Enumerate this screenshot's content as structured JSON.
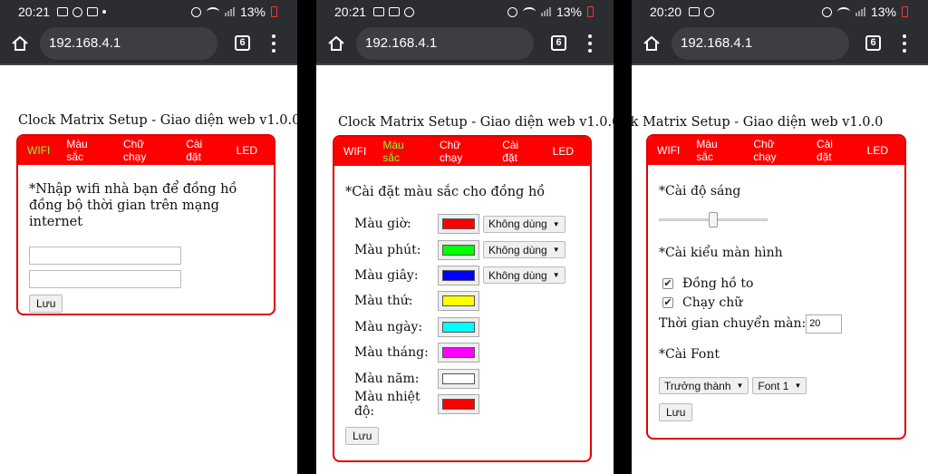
{
  "url": "192.168.4.1",
  "tab_count": "6",
  "page_title": "Clock Matrix Setup - Giao diện web v1.0.0",
  "nav": [
    "WIFI",
    "Màu sắc",
    "Chữ chạy",
    "Cài đặt",
    "LED"
  ],
  "phones": [
    {
      "time": "20:21",
      "battery": "13%"
    },
    {
      "time": "20:21",
      "battery": "13%"
    },
    {
      "time": "20:20",
      "battery": "13%"
    }
  ],
  "wifi_page": {
    "instruction": "*Nhập wifi nhà bạn để đồng hồ đồng bộ thời gian trên mạng internet",
    "ssid_value": "",
    "password_value": "",
    "save_label": "Lưu"
  },
  "color_page": {
    "heading": "*Cài đặt màu sắc cho đồng hồ",
    "rows": [
      {
        "label": "Màu giờ:",
        "color": "#ff0000",
        "option": "Không dùng"
      },
      {
        "label": "Màu phút:",
        "color": "#00ff00",
        "option": "Không dùng"
      },
      {
        "label": "Màu giây:",
        "color": "#0000ff",
        "option": "Không dùng"
      },
      {
        "label": "Màu thứ:",
        "color": "#ffff00"
      },
      {
        "label": "Màu ngày:",
        "color": "#00ffff"
      },
      {
        "label": "Màu tháng:",
        "color": "#ff00ff"
      },
      {
        "label": "Màu năm:",
        "color": "#ffffff"
      },
      {
        "label": "Màu nhiệt độ:",
        "color": "#ff0000"
      }
    ],
    "save_label": "Lưu"
  },
  "settings_page": {
    "brightness_heading": "*Cài độ sáng",
    "brightness_level": 0.5,
    "display_heading": "*Cài kiểu màn hình",
    "options": [
      {
        "label": "Đồng hồ to",
        "checked": true
      },
      {
        "label": "Chạy chữ",
        "checked": true
      }
    ],
    "transition_label": "Thời gian chuyển màn:",
    "transition_value": "20",
    "font_heading": "*Cài Font",
    "font_style": "Trưởng thành",
    "font_name": "Font 1",
    "save_label": "Lưu"
  }
}
